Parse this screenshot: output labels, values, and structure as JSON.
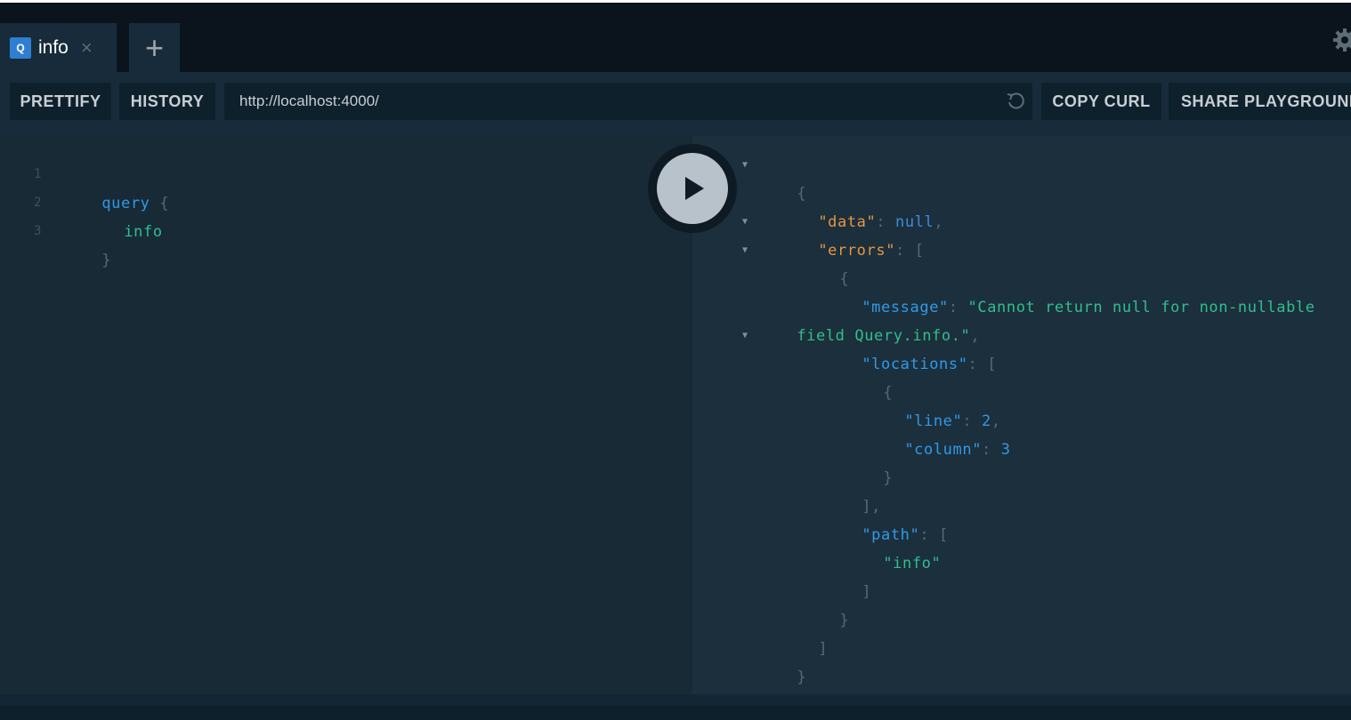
{
  "tabs": [
    {
      "badge": "Q",
      "label": "info",
      "close": "×"
    }
  ],
  "new_tab_label": "+",
  "toolbar": {
    "prettify": "PRETTIFY",
    "history": "HISTORY",
    "endpoint_url": "http://localhost:4000/",
    "copy_curl": "COPY CURL",
    "share": "SHARE PLAYGROUND"
  },
  "editor": {
    "line_numbers": [
      "1",
      "2",
      "3"
    ],
    "lines": [
      {
        "keyword": "query",
        "brace": "{"
      },
      {
        "field": "info"
      },
      {
        "brace": "}"
      }
    ]
  },
  "result": {
    "open_brace": "{",
    "data_key": "\"data\"",
    "colon": ": ",
    "data_value": "null",
    "comma": ",",
    "errors_key": "\"errors\"",
    "open_bracket": "[",
    "error_open": "{",
    "message_key": "\"message\"",
    "message_value_part1": "\"Cannot return null for non-nullable",
    "message_value_part2": "field Query.info.\"",
    "locations_key": "\"locations\"",
    "loc_open": "{",
    "line_key": "\"line\"",
    "line_value": "2",
    "column_key": "\"column\"",
    "column_value": "3",
    "loc_close": "}",
    "locations_close": "],",
    "path_key": "\"path\"",
    "path_value": "\"info\"",
    "path_close": "]",
    "error_close": "}",
    "errors_close": "]",
    "close_brace": "}"
  },
  "colors": {
    "editor_bg": "#172a36",
    "results_bg": "#1c2f3c",
    "accent_orange": "#e59543",
    "accent_blue": "#2f9ae8",
    "string_green": "#2fbf8f"
  },
  "icons": {
    "settings": "gear-icon",
    "reload": "reload-icon",
    "run": "play-icon"
  }
}
